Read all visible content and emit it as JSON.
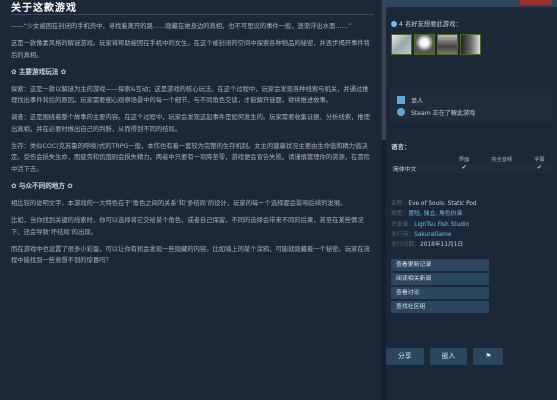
{
  "main": {
    "title": "关于这款游戏",
    "paragraphs": [
      "——“少女被困在封闭的手机壳中，寻找着离开的路……隐藏在她身边的真相，也不可思议的事件一般，逐渐浮出水面……”",
      "这是一款像素风格的解谜游戏。玩家将帮助被困在手机中的女生，在这个被封闭的空间中探索各种物品的秘密，并逐步揭开事件背后的真相。",
      "探索：这是一款以解谜为主的游戏——探索&互动；这是游戏的核心玩法。在这个过程中，玩家会发现各种线索与机关，并通过推理找出事件背后的原因。玩家需要细心观察场景中的每一个细节，与不同角色交谈，才能解开谜题，继续推进故事。",
      "调查：这是围绕着整个故事的主要内容。在这个过程中，玩家会发现这起事件是如何发生的。玩家需要收集证据、分析线索，推理出真相，并在必要时做出自己的判断，从而得到不同的结局。",
      "生存：类似COC(克苏鲁的呼唤)式的TRPG一般，本作也有着一套较为完整的生存机制。女主的健康状况主要由生命值和精力值决定。受伤会损失生命，而疲劳和饥饿则会损失精力。两者中只要有一项降至零，游戏便会宣告失败。请谨慎管理你的资源，在冒险中活下去。",
      "相比较的说明文字，本游戏的一大特色在于‘角色之间的关系’和‘多结局’的设计，玩家的每一个选择都会影响后续的发展。",
      "比如，当你找到关键的线索时，你可以选择将它交给某个角色，或者自己保留。不同的选择会带来不同的后果，甚至在某些情况下，还会导致‘坏结局’的出现。",
      "而在游戏中也设置了很多小彩蛋，可以让你有机会发现一些隐藏的内容。比如墙上的某个涂鸦，可能就隐藏着一个秘密。玩家在流程中能找到一些意想不到的惊喜吗？"
    ],
    "sections": [
      "✿ 主要游戏玩法 ✿",
      "✿ 与众不同的地方 ✿"
    ]
  },
  "sidebar": {
    "friends_title": "4 名好友想要此游戏：",
    "features": [
      "单人",
      "Steam 正在了解此游戏"
    ],
    "lang_title": "语言：",
    "lang_headers": [
      "",
      "界面",
      "完全音频",
      "字幕"
    ],
    "lang_rows": [
      {
        "lang": "简体中文",
        "ui": "✔",
        "audio": "",
        "subs": "✔"
      }
    ],
    "details": {
      "name_label": "名称：",
      "name": "Eve of Souls: Static Pod",
      "genre_label": "类型：",
      "genre": "冒险, 独立, 角色扮演",
      "dev_label": "开发者：",
      "dev": "LighTsu Fish Studio",
      "pub_label": "发行商：",
      "pub": "SakuraGame",
      "date_label": "发行日期：",
      "date": "2018年11月1日"
    },
    "links": [
      "查看更新记录",
      "阅读相关新闻",
      "查看讨论",
      "查找社区组"
    ],
    "buttons": [
      "分享",
      "嵌入",
      "⚑"
    ]
  },
  "colors": {
    "background": "#1b2838",
    "accent": "#67c1f5",
    "button": "#2a475e"
  }
}
